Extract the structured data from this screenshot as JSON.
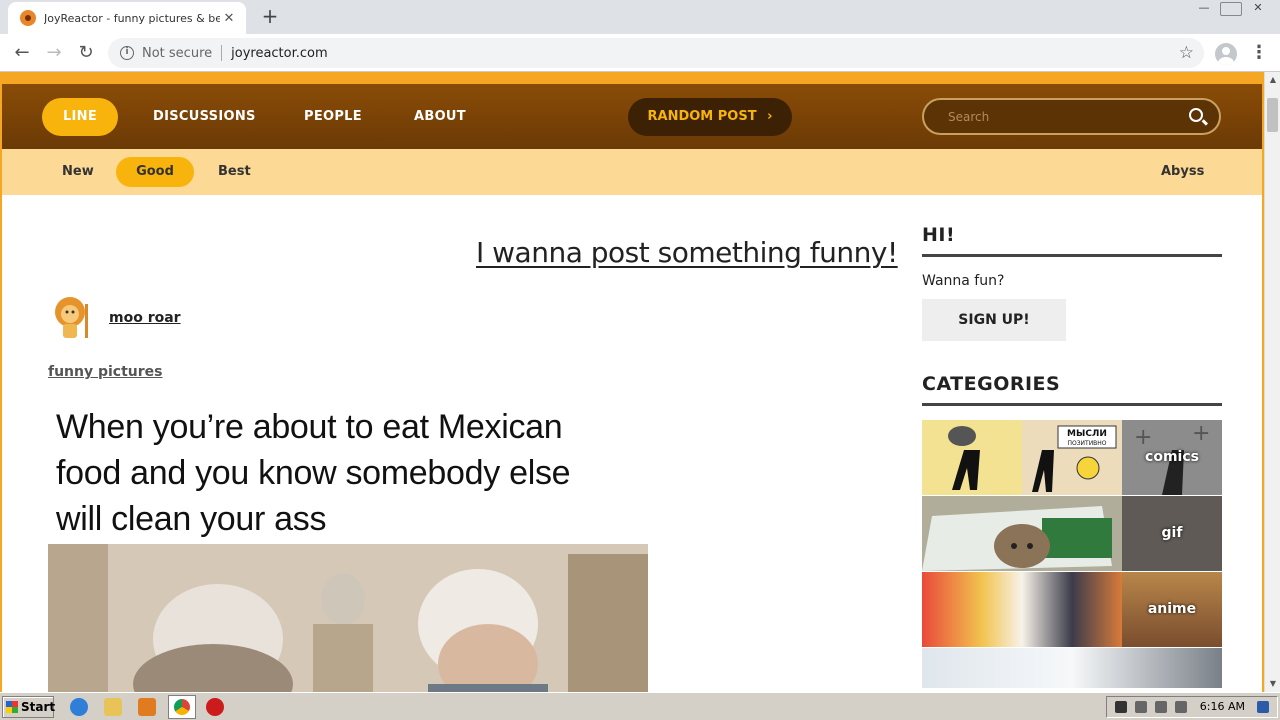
{
  "browser": {
    "tab_title": "JoyReactor - funny pictures & best j",
    "tab_close": "✕",
    "new_tab": "+",
    "security": "Not secure",
    "url": "joyreactor.com"
  },
  "site": {
    "nav": {
      "line": "LINE",
      "discussions": "DISCUSSIONS",
      "people": "PEOPLE",
      "about": "ABOUT",
      "random": "RANDOM POST",
      "search_placeholder": "Search"
    },
    "subnav": {
      "new": "New",
      "good": "Good",
      "best": "Best",
      "abyss": "Abyss"
    },
    "post_cta": "I wanna post something funny!",
    "post": {
      "author": "moo roar",
      "tag": "funny pictures",
      "caption": [
        "When you’re about to eat Mexican",
        "food and you know somebody else",
        "will clean your ass"
      ]
    },
    "sidebar": {
      "hi_title": "HI!",
      "greeting": "Wanna fun?",
      "signup": "SIGN UP!",
      "categories_title": "CATEGORIES",
      "categories": [
        {
          "label": "comics",
          "thumb_text": "МЫСЛИ ПОЗИТИВНО"
        },
        {
          "label": "gif"
        },
        {
          "label": "anime"
        }
      ]
    }
  },
  "taskbar": {
    "start": "Start",
    "clock": "6:16 AM"
  },
  "colors": {
    "brand_orange": "#f8b40d",
    "nav_brown": "#7a4306",
    "subnav_bg": "#fcd994"
  }
}
